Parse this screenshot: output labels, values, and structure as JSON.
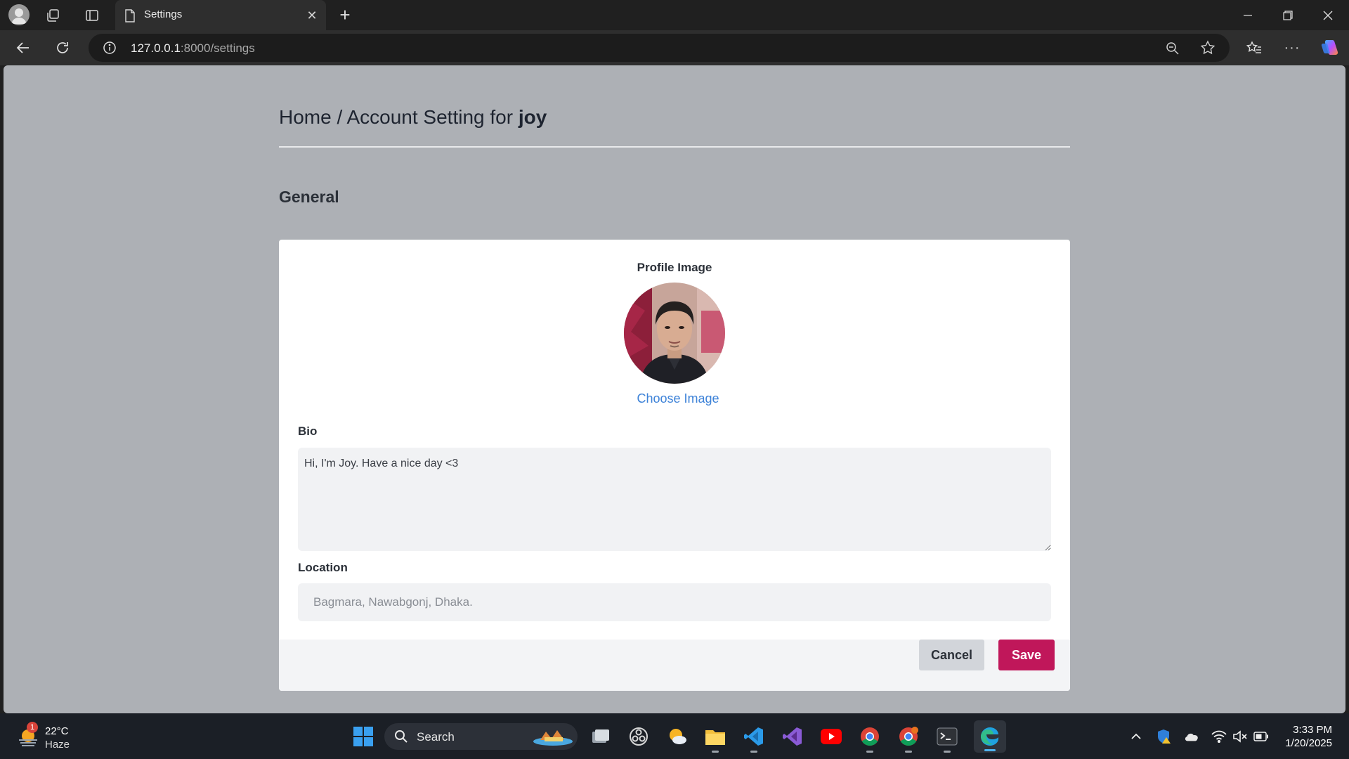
{
  "browser": {
    "tab_title": "Settings",
    "url_host": "127.0.0.1",
    "url_path": ":8000/settings"
  },
  "page": {
    "breadcrumb_prefix": "Home / Account Setting for",
    "username": "joy",
    "section_heading": "General",
    "profile_image_label": "Profile Image",
    "choose_image_label": "Choose Image",
    "bio_label": "Bio",
    "bio_value": "Hi, I'm Joy. Have a nice day <3",
    "location_label": "Location",
    "location_placeholder": "Bagmara, Nawabgonj, Dhaka.",
    "location_value": "",
    "cancel_label": "Cancel",
    "save_label": "Save"
  },
  "taskbar": {
    "weather_temp": "22°C",
    "weather_condition": "Haze",
    "weather_badge": "1",
    "search_label": "Search",
    "time": "3:33 PM",
    "date": "1/20/2025"
  },
  "colors": {
    "page_background": "#adb0b5",
    "save_button": "#c0175a",
    "link": "#3d82d8"
  }
}
